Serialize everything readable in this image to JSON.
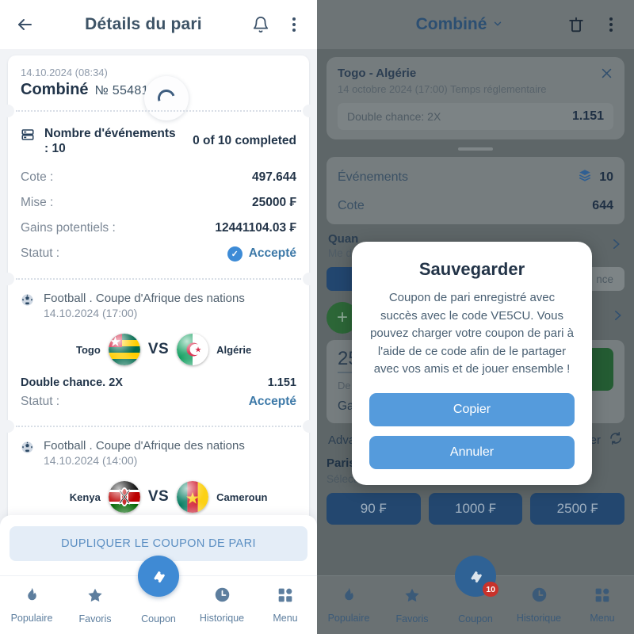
{
  "left": {
    "topbar": {
      "title": "Détails du pari",
      "back_icon": "back-arrow-icon",
      "bell_icon": "bell-icon",
      "menu_icon": "kebab-menu-icon"
    },
    "ticket": {
      "date": "14.10.2024 (08:34)",
      "type": "Combiné",
      "number": "№ 55481.      67",
      "events_label": "Nombre d'événements : 10",
      "events_progress": "0 of 10 completed",
      "rows": [
        {
          "label": "Cote :",
          "value": "497.644"
        },
        {
          "label": "Mise :",
          "value": "25000 ₣"
        },
        {
          "label": "Gains potentiels :",
          "value": "12441104.03 ₣"
        }
      ],
      "status_label": "Statut :",
      "status_value": "Accepté"
    },
    "matches": [
      {
        "competition": "Football . Coupe d'Afrique des nations",
        "datetime": "14.10.2024 (17:00)",
        "home": "Togo",
        "away": "Algérie",
        "vs": "VS",
        "bet_name": "Double chance. 2X",
        "bet_odd": "1.151",
        "status_label": "Statut :",
        "status_value": "Accepté"
      },
      {
        "competition": "Football . Coupe d'Afrique des nations",
        "datetime": "14.10.2024 (14:00)",
        "home": "Kenya",
        "away": "Cameroun",
        "vs": "VS"
      }
    ],
    "duplicate_button": "DUPLIQUER LE COUPON DE PARI",
    "nav": [
      {
        "label": "Populaire",
        "icon": "flame-icon"
      },
      {
        "label": "Favoris",
        "icon": "star-icon"
      },
      {
        "label": "Coupon",
        "icon": "ticket-icon"
      },
      {
        "label": "Historique",
        "icon": "clock-icon"
      },
      {
        "label": "Menu",
        "icon": "grid-icon"
      }
    ]
  },
  "right": {
    "topbar": {
      "title": "Combiné",
      "chevron": "⌄",
      "trash_icon": "trash-icon",
      "menu_icon": "kebab-menu-icon"
    },
    "event_card": {
      "title": "Togo - Algérie",
      "subtitle": "14 octobre 2024 (17:00) Temps réglementaire",
      "bet_name": "Double chance: 2X",
      "bet_odd": "1.151",
      "close_icon": "close-icon"
    },
    "summary": [
      {
        "label": "Événements",
        "value": "10",
        "icon": "layers-icon"
      },
      {
        "label": "Cote",
        "value": "644"
      }
    ],
    "quantity_row": {
      "title": "Quan",
      "sub": "Me d"
    },
    "chance_chip": "nce",
    "stake_value": "25",
    "stake_sub": "De ",
    "gains_text": "Gains potentiels : 12441104.03 ₣",
    "advancebet": {
      "label": "Advancebet disponible : –",
      "action": "Demander",
      "icon": "refresh-icon"
    },
    "rapid": {
      "title": "Paris rapides",
      "subtitle": "Sélectionnez un montant de mise pour placer un pari",
      "buttons": [
        "90 ₣",
        "1000 ₣",
        "2500 ₣"
      ]
    },
    "nav": [
      {
        "label": "Populaire",
        "icon": "flame-icon"
      },
      {
        "label": "Favoris",
        "icon": "star-icon"
      },
      {
        "label": "Coupon",
        "icon": "ticket-icon",
        "badge": "10"
      },
      {
        "label": "Historique",
        "icon": "clock-icon"
      },
      {
        "label": "Menu",
        "icon": "grid-icon"
      }
    ],
    "dialog": {
      "title": "Sauvegarder",
      "message": "Coupon de pari enregistré avec succès avec le code VE5CU. Vous pouvez charger votre coupon de pari à l'aide de ce code afin de le partager avec vos amis et de jouer ensemble !",
      "primary_button": "Copier",
      "secondary_button": "Annuler"
    }
  },
  "colors": {
    "accent_blue": "#3f8ad4",
    "dialog_blue": "#559bdc",
    "dark_navy": "#22354a",
    "status_blue": "#3d79a8",
    "badge_red": "#c8322b",
    "rapid_btn": "#23476f"
  }
}
